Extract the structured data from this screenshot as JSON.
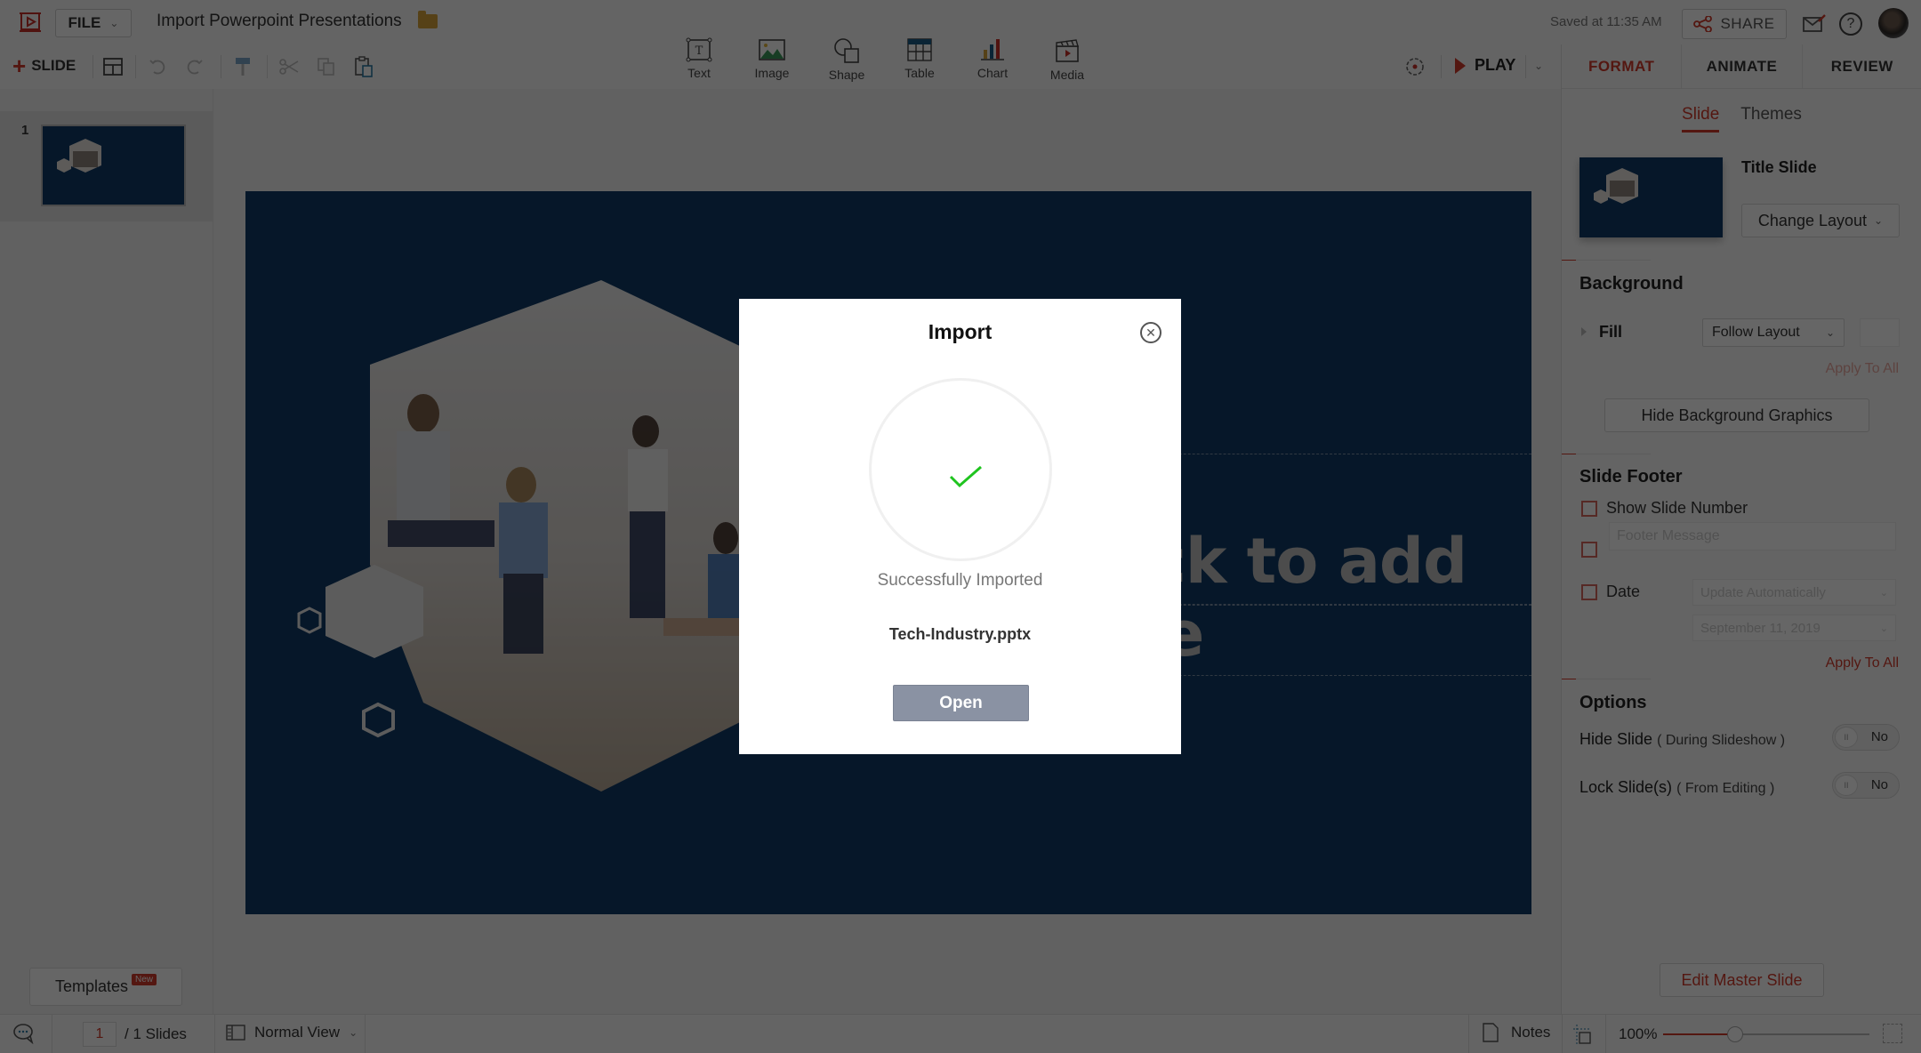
{
  "app": {
    "file_menu_label": "FILE",
    "document_title": "Import Powerpoint Presentations",
    "saved_status": "Saved at 11:35 AM",
    "share_label": "SHARE",
    "help_glyph": "?"
  },
  "toolbar": {
    "add_slide_label": "SLIDE",
    "insert_items": [
      {
        "label": "Text",
        "icon": "text-box-icon"
      },
      {
        "label": "Image",
        "icon": "image-icon"
      },
      {
        "label": "Shape",
        "icon": "shape-icon"
      },
      {
        "label": "Table",
        "icon": "table-icon"
      },
      {
        "label": "Chart",
        "icon": "chart-icon"
      },
      {
        "label": "Media",
        "icon": "media-clapper-icon"
      }
    ],
    "play_label": "PLAY"
  },
  "right_panel": {
    "tabs": [
      {
        "label": "FORMAT",
        "active": true
      },
      {
        "label": "ANIMATE",
        "active": false
      },
      {
        "label": "REVIEW",
        "active": false
      }
    ],
    "subtabs": [
      {
        "label": "Slide",
        "active": true
      },
      {
        "label": "Themes",
        "active": false
      }
    ],
    "layout_name": "Title Slide",
    "change_layout_label": "Change Layout",
    "background": {
      "title": "Background",
      "fill_label": "Fill",
      "fill_value": "Follow Layout",
      "apply_all_label": "Apply To All",
      "hide_graphics_label": "Hide Background Graphics"
    },
    "slide_footer": {
      "title": "Slide Footer",
      "show_slide_number_label": "Show Slide Number",
      "show_slide_number_checked": false,
      "footer_message_placeholder": "Footer Message",
      "footer_message_checked": false,
      "date_label": "Date",
      "date_checked": false,
      "date_mode_value": "Update Automatically",
      "date_value": "September 11, 2019",
      "apply_all_label": "Apply To All"
    },
    "options": {
      "title": "Options",
      "hide_slide_label": "Hide Slide",
      "hide_slide_sub": "( During Slideshow )",
      "hide_slide_state": "No",
      "lock_slide_label": "Lock Slide(s)",
      "lock_slide_sub": "( From Editing )",
      "lock_slide_state": "No",
      "toggle_knob_glyph": "II"
    },
    "edit_master_label": "Edit Master Slide"
  },
  "left_panel": {
    "slide_number": "1",
    "templates_label": "Templates",
    "templates_badge": "New"
  },
  "slide": {
    "title_placeholder": "Click to add title",
    "visible_title_fragment": "dd title"
  },
  "status_bar": {
    "current_page": "1",
    "total_pages_label": "/ 1 Slides",
    "view_mode": "Normal View",
    "notes_label": "Notes",
    "zoom_label": "100%",
    "zoom_fraction": 0.35
  },
  "modal": {
    "title": "Import",
    "status_text": "Successfully Imported",
    "file_name": "Tech-Industry.pptx",
    "open_label": "Open",
    "close_glyph": "✕",
    "colors": {
      "check": "#1fc41f",
      "button": "#8a92a3"
    }
  },
  "colors": {
    "accent": "#d23b2b",
    "slide_background": "#0f3a66"
  }
}
